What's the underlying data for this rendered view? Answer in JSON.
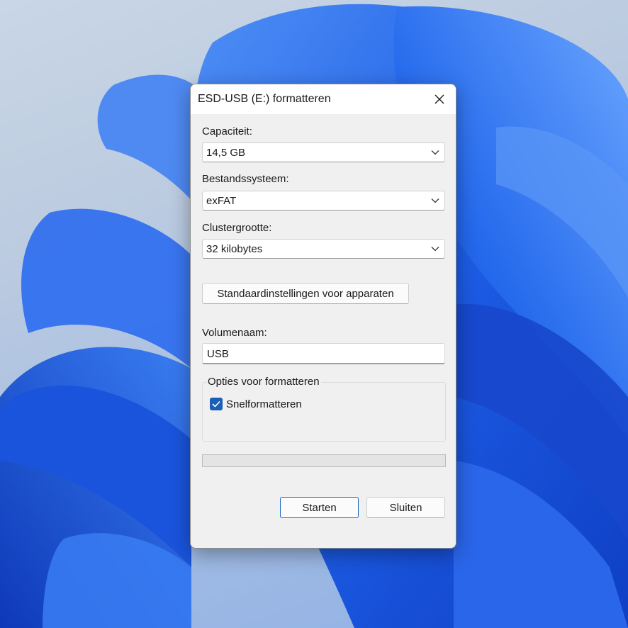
{
  "dialog": {
    "title": "ESD-USB (E:) formatteren",
    "close_icon": "close-icon"
  },
  "capacity": {
    "label": "Capaciteit:",
    "value": "14,5 GB"
  },
  "filesystem": {
    "label": "Bestandssysteem:",
    "value": "exFAT"
  },
  "cluster": {
    "label": "Clustergrootte:",
    "value": "32 kilobytes"
  },
  "defaults_button": {
    "label": "Standaardinstellingen voor apparaten"
  },
  "volume": {
    "label": "Volumenaam:",
    "value": "USB"
  },
  "options": {
    "title": "Opties voor formatteren",
    "quick_format": {
      "label": "Snelformatteren",
      "checked": true
    }
  },
  "progress": {
    "value": 0
  },
  "footer": {
    "start_label": "Starten",
    "close_label": "Sluiten"
  },
  "colors": {
    "accent": "#1b5fb5",
    "dialog_bg": "#f0f0f0",
    "wallpaper_blue": "#1f5fe0"
  }
}
